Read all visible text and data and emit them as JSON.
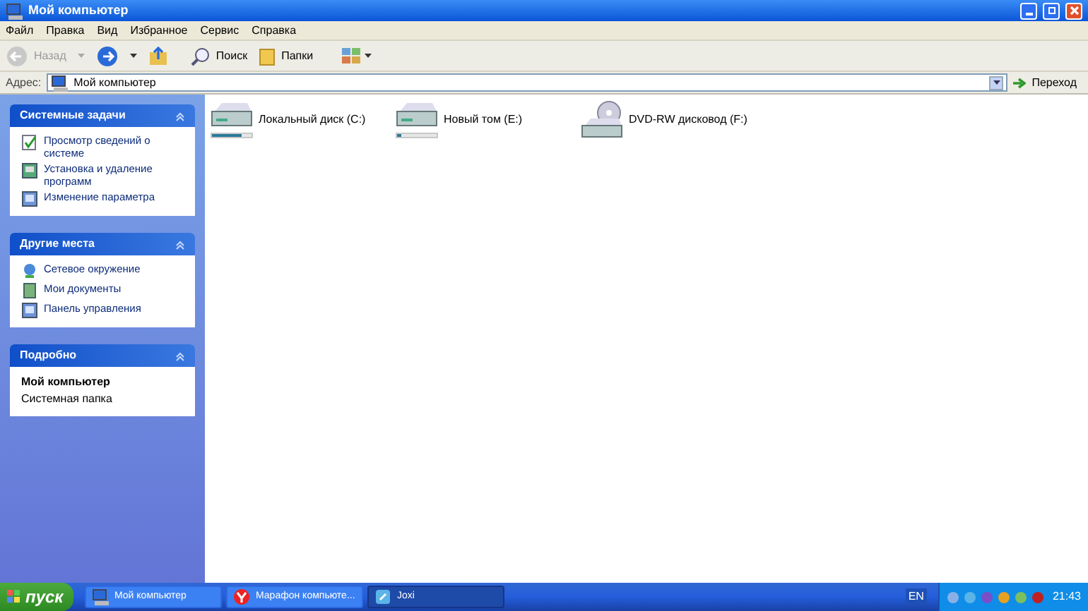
{
  "window": {
    "title": "Мой компьютер"
  },
  "menu": [
    "Файл",
    "Правка",
    "Вид",
    "Избранное",
    "Сервис",
    "Справка"
  ],
  "toolbar": {
    "back": {
      "label": "Назад",
      "disabled": true
    },
    "search": "Поиск",
    "folders": "Папки"
  },
  "address": {
    "label": "Адрес:",
    "value": "Мой компьютер",
    "go": "Переход"
  },
  "panels": [
    {
      "title": "Системные задачи",
      "items": [
        {
          "label": "Просмотр сведений о системе"
        },
        {
          "label": "Установка и удаление программ"
        },
        {
          "label": "Изменение параметра"
        }
      ]
    },
    {
      "title": "Другие места",
      "items": [
        {
          "label": "Сетевое окружение"
        },
        {
          "label": "Мои документы"
        },
        {
          "label": "Панель управления"
        }
      ]
    },
    {
      "title": "Подробно",
      "details": {
        "name": "Мой компьютер",
        "type": "Системная папка"
      }
    }
  ],
  "drives": [
    {
      "label": "Локальный диск (C:)",
      "kind": "disk",
      "level": 0.75
    },
    {
      "label": "Новый том (E:)",
      "kind": "disk",
      "level": 0.12
    },
    {
      "label": "DVD-RW дисковод (F:)",
      "kind": "dvd"
    }
  ],
  "taskbar": {
    "start": "пуск",
    "tasks": [
      {
        "label": "Мой компьютер",
        "selected": false
      },
      {
        "label": "Марафон компьюте...",
        "selected": false
      },
      {
        "label": "Joxi",
        "selected": true
      }
    ],
    "language": "EN",
    "clock": "21:43"
  }
}
